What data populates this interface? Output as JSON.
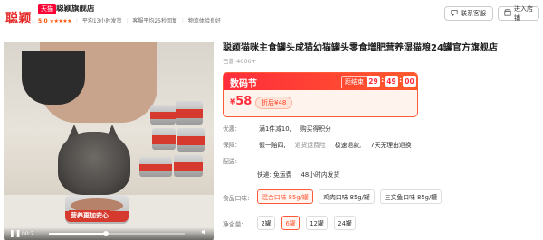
{
  "header": {
    "logo": "聪颖",
    "tmall_tag": "天猫",
    "store_name": "聪颖旗舰店",
    "rating_score": "5.0",
    "rating_stars": "★★★★★",
    "stat1": "平均13小时发货",
    "stat2": "客服平均25秒回复",
    "stat3": "物流体验良好",
    "service_btn": "联系客服",
    "enter_btn": "进入店铺"
  },
  "video": {
    "caption": "营养更加安心",
    "time": "00:2",
    "progress": 0.42
  },
  "product": {
    "title": "聪颖猫咪主食罐头成猫幼猫罐头零食增肥营养湿猫粮24罐官方旗舰店",
    "sold": "已售 4000+"
  },
  "promo": {
    "name": "数码节",
    "countdown_label": "距结束",
    "hours": "29",
    "minutes": "49",
    "seconds": "00",
    "price_currency": "¥",
    "price": "58",
    "coupon": "折后¥48"
  },
  "info": {
    "discount_key": "优惠:",
    "discount_val1": "满1件减10,",
    "discount_val2": "购买得积分",
    "guarantee_key": "保障:",
    "guarantee_val1": "假一赔四,",
    "guarantee_val2": "退货运费险",
    "guarantee_val3": "极速退款,",
    "guarantee_val4": "7天无理由退换",
    "delivery_key": "配送:",
    "delivery_val1": "快递: 免运费",
    "delivery_val2": "48小时内发货"
  },
  "flavor": {
    "label": "食品口味:",
    "options": [
      "混合口味 85g/罐",
      "鸡肉口味 85g/罐",
      "三文鱼口味 85g/罐"
    ],
    "selected": 0
  },
  "weight": {
    "label": "净含量:",
    "options": [
      "2罐",
      "6罐",
      "12罐",
      "24罐"
    ],
    "selected": 1
  },
  "colors": {
    "accent": "#ff2d3c",
    "accent_orange": "#ff5a38",
    "tmall_red": "#ff0036"
  }
}
